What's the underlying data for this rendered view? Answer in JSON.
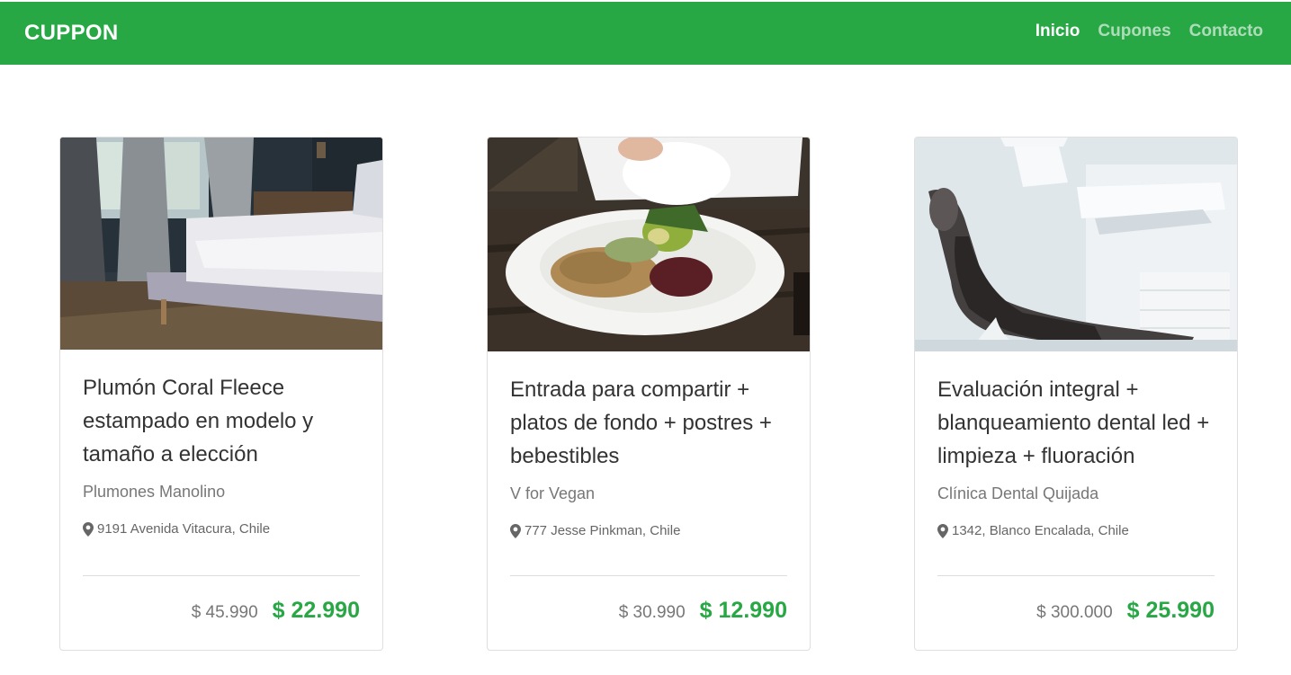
{
  "brand": "CUPPON",
  "nav": [
    {
      "label": "Inicio",
      "active": true
    },
    {
      "label": "Cupones",
      "active": false
    },
    {
      "label": "Contacto",
      "active": false
    }
  ],
  "deals": [
    {
      "image": "bedroom-bed-photo",
      "title": "Plumón Coral Fleece estampado en modelo y tamaño a elección",
      "vendor": "Plumones Manolino",
      "address": "9191 Avenida Vitacura, Chile",
      "old_price": "$ 45.990",
      "new_price": "$ 22.990"
    },
    {
      "image": "salad-plate-photo",
      "title": "Entrada para compartir + platos de fondo + postres + bebestibles",
      "vendor": "V for Vegan",
      "address": "777 Jesse Pinkman, Chile",
      "old_price": "$ 30.990",
      "new_price": "$ 12.990"
    },
    {
      "image": "dental-chair-photo",
      "title": "Evaluación integral + blanqueamiento dental led + limpieza + fluoración",
      "vendor": "Clínica Dental Quijada",
      "address": "1342, Blanco Encalada, Chile",
      "old_price": "$ 300.000",
      "new_price": "$ 25.990"
    }
  ],
  "colors": {
    "brand_green": "#28a745",
    "nav_inactive": "#a9dcb5"
  }
}
